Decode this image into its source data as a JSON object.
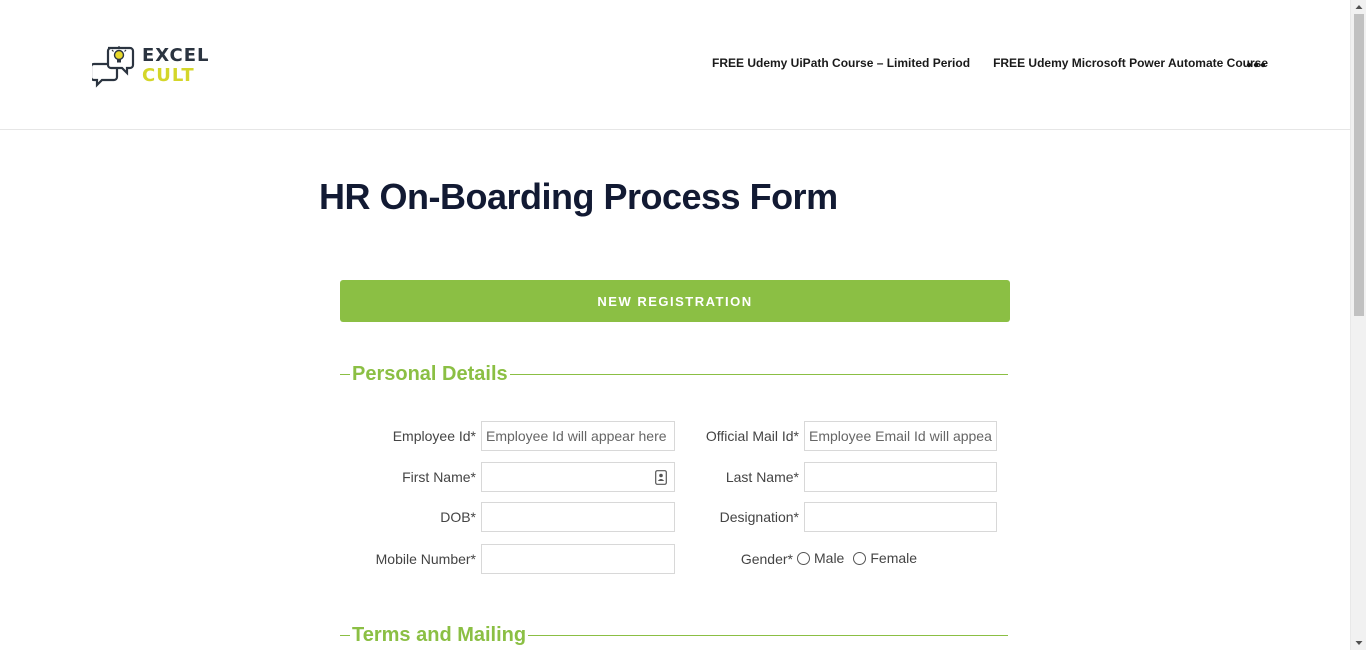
{
  "header": {
    "logo": {
      "line1": "EXCEL",
      "line2": "CULT"
    },
    "nav": [
      {
        "label": "FREE Udemy UiPath Course – Limited Period"
      },
      {
        "label": "FREE Udemy Microsoft Power Automate Course"
      }
    ],
    "more_icon": "ellipsis-icon"
  },
  "page": {
    "title": "HR On-Boarding Process Form",
    "registration_bar": "NEW REGISTRATION"
  },
  "sections": {
    "personal": "Personal Details",
    "terms": "Terms and Mailing"
  },
  "form": {
    "employee_id": {
      "label": "Employee Id*",
      "placeholder": "Employee Id will appear here"
    },
    "official_mail": {
      "label": "Official Mail Id*",
      "placeholder": "Employee Email Id will appear"
    },
    "first_name": {
      "label": "First Name*",
      "value": ""
    },
    "last_name": {
      "label": "Last Name*",
      "value": ""
    },
    "dob": {
      "label": "DOB*",
      "value": ""
    },
    "designation": {
      "label": "Designation*",
      "value": ""
    },
    "mobile": {
      "label": "Mobile Number*",
      "value": ""
    },
    "gender": {
      "label": "Gender*",
      "options": [
        "Male",
        "Female"
      ]
    }
  },
  "colors": {
    "accent": "#8bbf44",
    "title": "#121a33",
    "logo_dark": "#2b3440",
    "logo_yellow": "#d4d62a"
  }
}
